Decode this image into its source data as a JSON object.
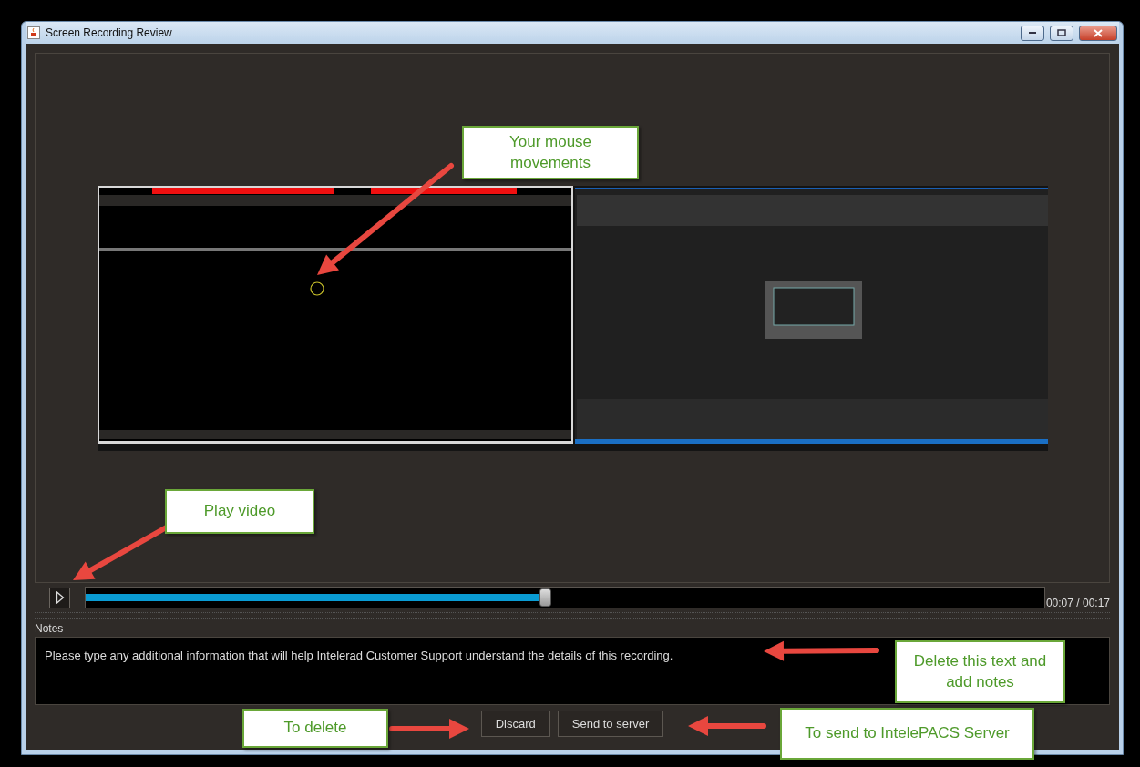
{
  "window": {
    "title": "Screen Recording Review"
  },
  "player": {
    "level": 0.48,
    "time": "00:07 / 00:17"
  },
  "notes": {
    "label": "Notes",
    "value": "Please type any additional information that will help Intelerad Customer Support understand the details of this recording."
  },
  "buttons": [
    "Discard",
    "Send to server"
  ],
  "annotations": [
    {
      "text": "Your mouse movements"
    },
    {
      "text": "Play video"
    },
    {
      "text": "Delete this text and add notes"
    },
    {
      "text": "To delete"
    },
    {
      "text": "To send to IntelePACS Server"
    }
  ]
}
